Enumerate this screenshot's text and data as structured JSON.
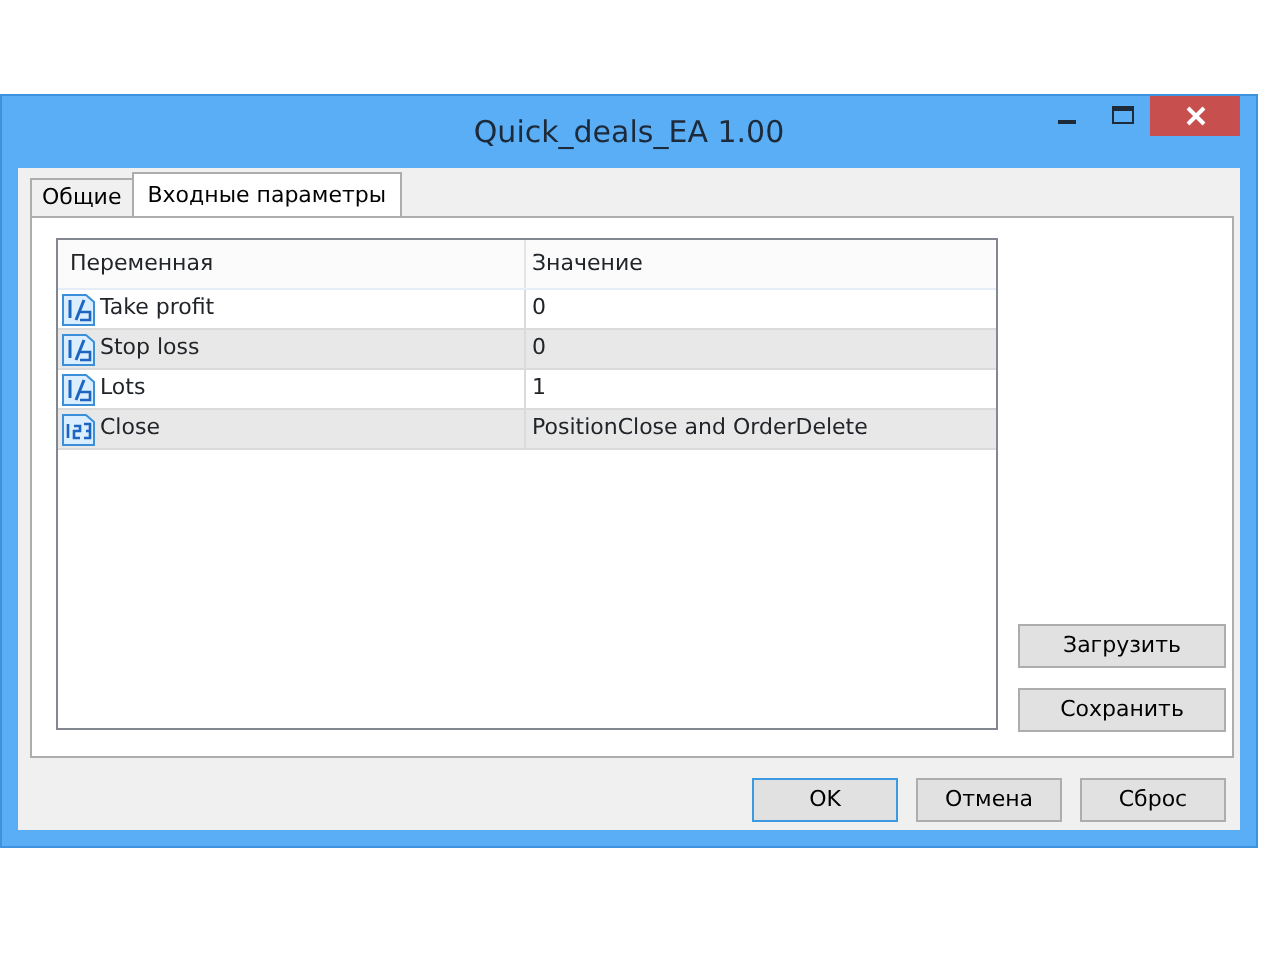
{
  "window": {
    "title": "Quick_deals_EA 1.00"
  },
  "tabs": [
    {
      "label": "Общие",
      "selected": false
    },
    {
      "label": "Входные параметры",
      "selected": true
    }
  ],
  "table": {
    "columns": [
      "Переменная",
      "Значение"
    ],
    "rows": [
      {
        "kind": "double",
        "name": "Take profit",
        "value": "0"
      },
      {
        "kind": "double",
        "name": "Stop loss",
        "value": "0"
      },
      {
        "kind": "double",
        "name": "Lots",
        "value": "1"
      },
      {
        "kind": "integer",
        "name": "Close",
        "value": "PositionClose and OrderDelete"
      }
    ]
  },
  "side_buttons": [
    "Загрузить",
    "Сохранить"
  ],
  "buttons": [
    {
      "label": "OK",
      "default": true
    },
    {
      "label": "Отмена",
      "default": false
    },
    {
      "label": "Сброс",
      "default": false
    }
  ]
}
